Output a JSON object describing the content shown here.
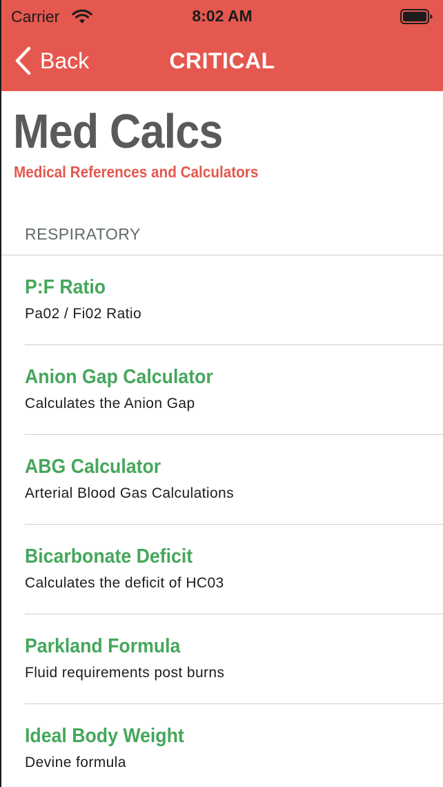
{
  "status_bar": {
    "carrier": "Carrier",
    "time": "8:02 AM"
  },
  "nav": {
    "back_label": "Back",
    "title": "CRITICAL"
  },
  "app": {
    "title": "Med Calcs",
    "subtitle": "Medical References and Calculators"
  },
  "section": {
    "header": "RESPIRATORY"
  },
  "items": [
    {
      "title": "P:F Ratio",
      "description": "Pa02 / Fi02 Ratio"
    },
    {
      "title": "Anion Gap Calculator",
      "description": "Calculates the Anion Gap"
    },
    {
      "title": "ABG Calculator",
      "description": "Arterial Blood Gas Calculations"
    },
    {
      "title": "Bicarbonate Deficit",
      "description": "Calculates the deficit of HC03"
    },
    {
      "title": "Parkland Formula",
      "description": "Fluid requirements post burns"
    },
    {
      "title": "Ideal Body Weight",
      "description": "Devine formula"
    }
  ],
  "colors": {
    "header_bg": "#e5584f",
    "accent_red": "#e5584f",
    "item_title_green": "#45a75b",
    "app_title_gray": "#5a5a5a",
    "divider": "#cfcfcf"
  },
  "icons": {
    "wifi": "wifi-icon",
    "battery": "battery-icon",
    "back": "chevron-left-icon"
  }
}
